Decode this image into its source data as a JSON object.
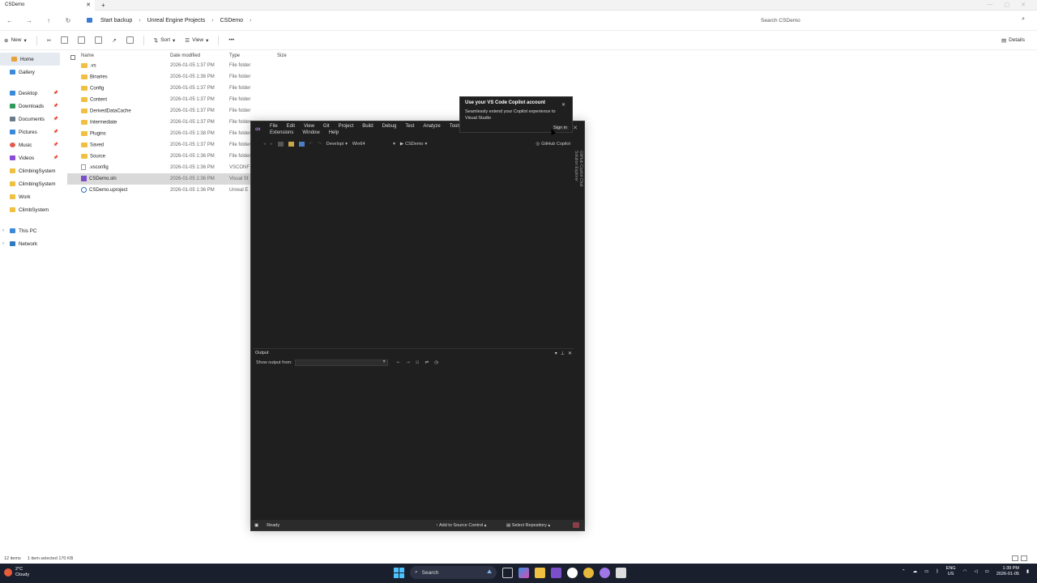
{
  "explorer": {
    "tab_title": "CSDemo",
    "breadcrumb": [
      "Start backup",
      "Unreal Engine Projects",
      "CSDemo"
    ],
    "search_placeholder": "Search CSDemo",
    "toolbar": {
      "new": "New",
      "sort": "Sort",
      "view": "View",
      "details": "Details"
    },
    "sidebar": {
      "home": "Home",
      "gallery": "Gallery",
      "quick": [
        "Desktop",
        "Downloads",
        "Documents",
        "Pictures",
        "Music",
        "Videos",
        "ClimbingSystem",
        "ClimbingSystem",
        "Work",
        "ClimbSystem"
      ],
      "this_pc": "This PC",
      "network": "Network"
    },
    "columns": {
      "name": "Name",
      "date": "Date modified",
      "type": "Type",
      "size": "Size"
    },
    "files": [
      {
        "name": ".vs",
        "date": "2026-01-05 1:37 PM",
        "type": "File folder"
      },
      {
        "name": "Binaries",
        "date": "2026-01-05 1:36 PM",
        "type": "File folder"
      },
      {
        "name": "Config",
        "date": "2026-01-05 1:37 PM",
        "type": "File folder"
      },
      {
        "name": "Content",
        "date": "2026-01-05 1:37 PM",
        "type": "File folder"
      },
      {
        "name": "DerivedDataCache",
        "date": "2026-01-05 1:37 PM",
        "type": "File folder"
      },
      {
        "name": "Intermediate",
        "date": "2026-01-05 1:37 PM",
        "type": "File folder"
      },
      {
        "name": "Plugins",
        "date": "2026-01-05 1:38 PM",
        "type": "File folder"
      },
      {
        "name": "Saved",
        "date": "2026-01-05 1:37 PM",
        "type": "File folder"
      },
      {
        "name": "Source",
        "date": "2026-01-05 1:36 PM",
        "type": "File folder"
      },
      {
        "name": ".vsconfig",
        "date": "2026-01-05 1:36 PM",
        "type": "VSCONF"
      },
      {
        "name": "CSDemo.sln",
        "date": "2026-01-05 1:36 PM",
        "type": "Visual St"
      },
      {
        "name": "CSDemo.uproject",
        "date": "2026-01-05 1:36 PM",
        "type": "Unreal E"
      }
    ],
    "status": {
      "count": "12 items",
      "selected": "1 item selected  170 KB"
    }
  },
  "vs": {
    "menu": [
      "File",
      "Edit",
      "View",
      "Git",
      "Project",
      "Build",
      "Debug",
      "Test",
      "Analyze",
      "Tools",
      "Extensions",
      "Window",
      "Help"
    ],
    "config": "Developi",
    "platform": "Win64",
    "startup": "CSDemo",
    "copilot": "GitHub Copilot",
    "side_tabs": [
      "GitHub Copilot Chat",
      "Solution Explorer"
    ],
    "output": {
      "title": "Output",
      "show_from": "Show output from:"
    },
    "status": {
      "ready": "Ready",
      "source_control": "Add to Source Control",
      "repo": "Select Repository"
    }
  },
  "popup": {
    "title": "Use your VS Code Copilot account",
    "body": "Seamlessly extend your Copilot experience to Visual Studio",
    "sign_in": "Sign in"
  },
  "taskbar": {
    "temp": "2°C",
    "weather": "Cloudy",
    "search": "Search",
    "lang": "ENG",
    "region": "US",
    "time": "1:39 PM",
    "date": "2026-01-05"
  }
}
